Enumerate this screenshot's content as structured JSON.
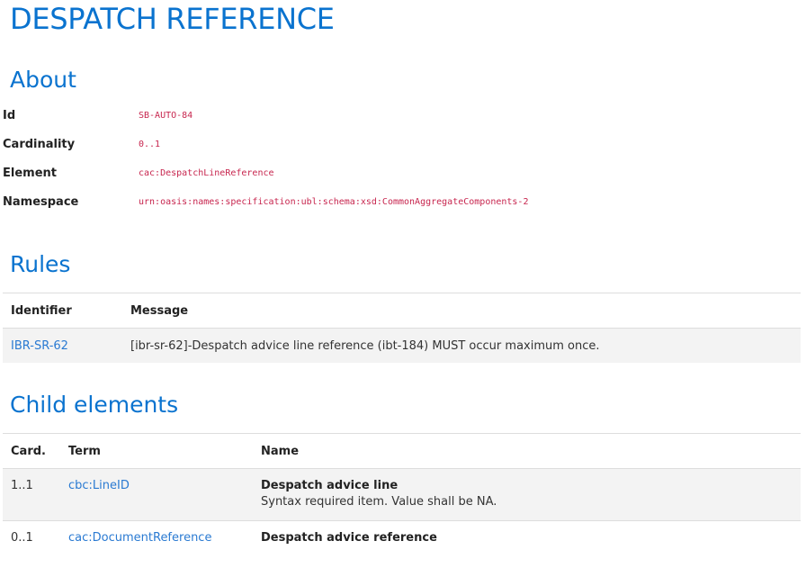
{
  "page": {
    "title": "DESPATCH REFERENCE"
  },
  "about": {
    "heading": "About",
    "rows": [
      {
        "term": "Id",
        "value": "SB-AUTO-84"
      },
      {
        "term": "Cardinality",
        "value": "0..1"
      },
      {
        "term": "Element",
        "value": "cac:DespatchLineReference"
      },
      {
        "term": "Namespace",
        "value": "urn:oasis:names:specification:ubl:schema:xsd:CommonAggregateComponents-2"
      }
    ]
  },
  "rules": {
    "heading": "Rules",
    "columns": [
      "Identifier",
      "Message"
    ],
    "rows": [
      {
        "identifier": "IBR-SR-62",
        "message": "[ibr-sr-62]-Despatch advice line reference (ibt-184) MUST occur maximum once."
      }
    ]
  },
  "children": {
    "heading": "Child elements",
    "columns": [
      "Card.",
      "Term",
      "Name"
    ],
    "rows": [
      {
        "card": "1..1",
        "term": "cbc:LineID",
        "name": "Despatch advice line",
        "description": "Syntax required item. Value shall be NA."
      },
      {
        "card": "0..1",
        "term": "cac:DocumentReference",
        "name": "Despatch advice reference"
      }
    ]
  }
}
